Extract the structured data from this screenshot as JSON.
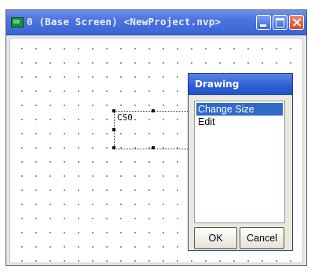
{
  "window": {
    "title": "0 (Base Screen) <NewProject.nvp>",
    "buttons": {
      "minimize": "minimize",
      "maximize": "maximize",
      "close": "close"
    }
  },
  "canvas": {
    "selected_object_label": "CS0"
  },
  "dialog": {
    "title": "Drawing",
    "list_items": [
      "Change Size",
      "Edit"
    ],
    "selected_index": 0,
    "ok_label": "OK",
    "cancel_label": "Cancel"
  },
  "colors": {
    "titlebar": "#3a63d3",
    "selection_highlight": "#316ac5",
    "dialog_background": "#ece9d8"
  },
  "icons": [
    "app-icon",
    "minimize-icon",
    "maximize-icon",
    "close-icon"
  ]
}
